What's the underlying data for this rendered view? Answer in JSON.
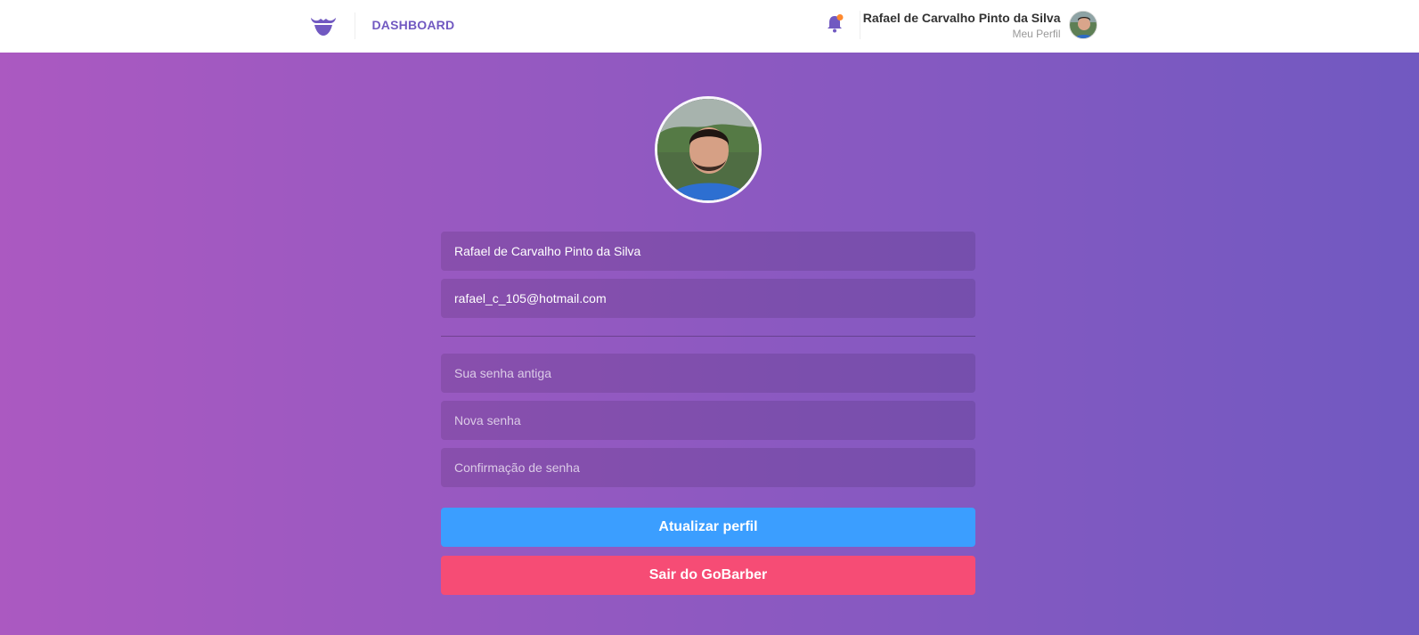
{
  "header": {
    "nav_link": "DASHBOARD",
    "profile_name": "Rafael de Carvalho Pinto da Silva",
    "profile_link": "Meu Perfil",
    "logo_icon": "mustache-logo-icon",
    "notification_icon": "bell-icon",
    "notification_badge_color": "#ff892e"
  },
  "form": {
    "avatar_alt": "profile photo",
    "name_value": "Rafael de Carvalho Pinto da Silva",
    "email_value": "rafael_c_105@hotmail.com",
    "old_password_placeholder": "Sua senha antiga",
    "new_password_placeholder": "Nova senha",
    "confirm_password_placeholder": "Confirmação de senha",
    "update_button": "Atualizar perfil",
    "logout_button": "Sair do GoBarber"
  },
  "colors": {
    "brand": "#7159c1",
    "gradient_start": "#ab59c1",
    "gradient_end": "#7159c1",
    "primary_button": "#3b9eff",
    "danger_button": "#f64c75"
  }
}
